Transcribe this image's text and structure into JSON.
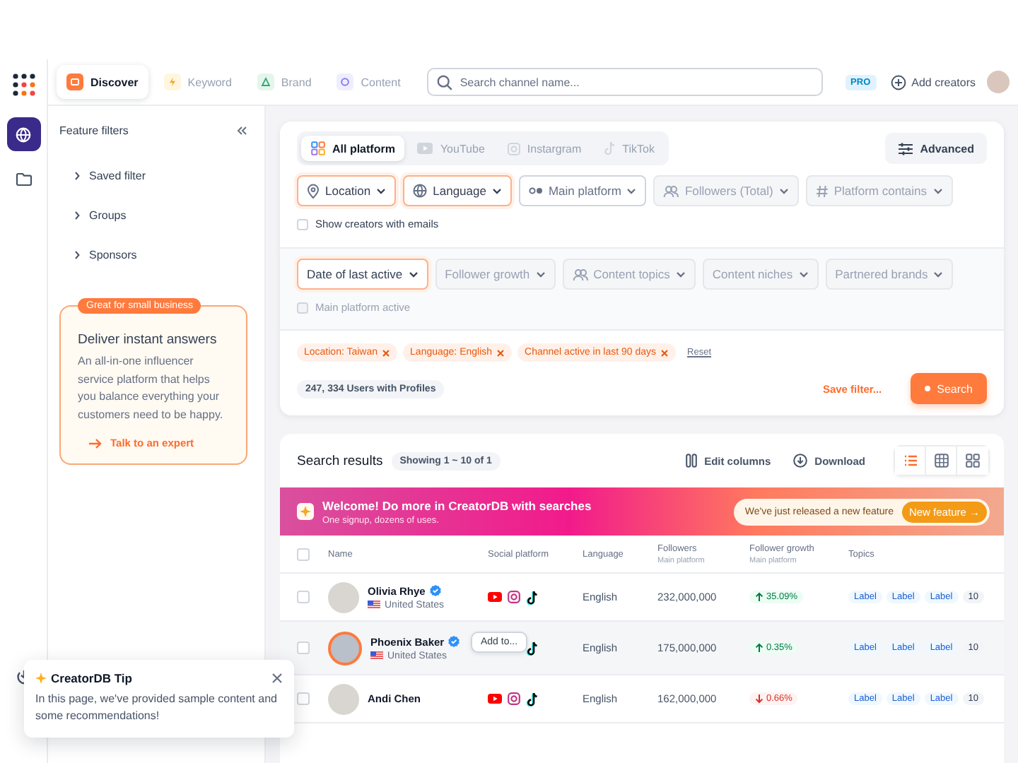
{
  "rail": {
    "items": [
      {
        "selected": true
      },
      {
        "selected": false
      }
    ]
  },
  "top_nav": {
    "tabs": [
      {
        "label": "Discover",
        "selected": true
      },
      {
        "label": "Keyword",
        "selected": false
      },
      {
        "label": "Brand",
        "selected": false
      },
      {
        "label": "Content",
        "selected": false
      }
    ],
    "search": {
      "placeholder": "Search channel name..."
    },
    "plan_badge": "PRO",
    "add_button": "Add creators"
  },
  "sidebar": {
    "title": "Feature filters",
    "items": [
      {
        "label": "Saved filter",
        "expanded": false
      },
      {
        "label": "Groups",
        "expanded": false
      },
      {
        "label": "Sponsors",
        "expanded": false
      }
    ],
    "promo": {
      "badge": "Great for small business",
      "title": "Deliver instant answers",
      "text": "An all-in-one influencer service platform that helps you balance everything your customers need to be happy.",
      "link": "Talk to an expert"
    }
  },
  "filters": {
    "platform_tabs": [
      {
        "label": "All platform",
        "selected": true
      },
      {
        "label": "YouTube",
        "selected": false
      },
      {
        "label": "Instargram",
        "selected": false
      },
      {
        "label": "TikTok",
        "selected": false
      }
    ],
    "advanced_button": "Advanced",
    "primary": [
      {
        "label": "Location",
        "active": true,
        "disabled": false
      },
      {
        "label": "Language",
        "active": true,
        "disabled": false
      },
      {
        "label": "Main platform",
        "active": false,
        "disabled": false
      },
      {
        "label": "Followers (Total)",
        "active": false,
        "disabled": true
      },
      {
        "label": "Platform contains",
        "active": false,
        "disabled": true
      }
    ],
    "email_option": {
      "label": "Show creators with emails",
      "checked": false,
      "disabled": false
    },
    "secondary": [
      {
        "label": "Date of last active",
        "active": true,
        "disabled": false
      },
      {
        "label": "Follower growth",
        "active": false,
        "disabled": true
      },
      {
        "label": "Content topics",
        "active": false,
        "disabled": true
      },
      {
        "label": "Content niches",
        "active": false,
        "disabled": true
      },
      {
        "label": "Partnered brands",
        "active": false,
        "disabled": true
      }
    ],
    "active_option": {
      "label": "Main platform active",
      "checked": false,
      "disabled": true
    },
    "chips": [
      {
        "label": "Location: Taiwan"
      },
      {
        "label": "Language: English"
      },
      {
        "label": "Channel active in last 90 days"
      }
    ],
    "reset": "Reset",
    "count": "247, 334 Users with Profiles",
    "save_link": "Save filter...",
    "search_button": "Search"
  },
  "results": {
    "title": "Search results",
    "showing": "Showing 1 ~ 10 of 1",
    "edit_columns": "Edit columns",
    "download": "Download",
    "views": [
      {
        "selected": true
      },
      {
        "selected": false
      },
      {
        "selected": false
      }
    ],
    "banner": {
      "title": "Welcome! Do more in CreatorDB with searches",
      "subtitle": "One signup, dozens of uses.",
      "note": "We've just released a new feature",
      "button": "New feature →"
    },
    "table": {
      "all_checked": false,
      "columns": [
        {
          "label": "Name"
        },
        {
          "label": "Social platform"
        },
        {
          "label": "Language"
        },
        {
          "label": "Followers",
          "sublabel": "Main platform"
        },
        {
          "label": "Follower growth",
          "sublabel": "Main platform"
        },
        {
          "label": "Topics"
        }
      ],
      "rows": [
        {
          "name": "Olivia Rhye",
          "verified": true,
          "country": "United States",
          "language": "English",
          "followers": "232,000,000",
          "growth": "35.09%",
          "rising": true,
          "topics": [
            "Label",
            "Label",
            "Label"
          ],
          "topics_more": "10",
          "checked": false,
          "selected": false
        },
        {
          "name": "Phoenix Baker",
          "verified": true,
          "country": "United States",
          "add_button": "Add to...",
          "language": "English",
          "followers": "175,000,000",
          "growth": "0.35%",
          "rising": true,
          "topics": [
            "Label",
            "Label",
            "Label"
          ],
          "topics_more": "10",
          "checked": false,
          "selected": true
        },
        {
          "name": "Andi Chen",
          "verified": false,
          "language": "English",
          "followers": "162,000,000",
          "growth": "0.66%",
          "rising": false,
          "topics": [
            "Label",
            "Label",
            "Label"
          ],
          "topics_more": "10",
          "checked": false,
          "selected": false
        }
      ]
    }
  },
  "tip": {
    "title": "CreatorDB Tip",
    "text": "In this page, we've provided sample content and some recommendations!"
  }
}
